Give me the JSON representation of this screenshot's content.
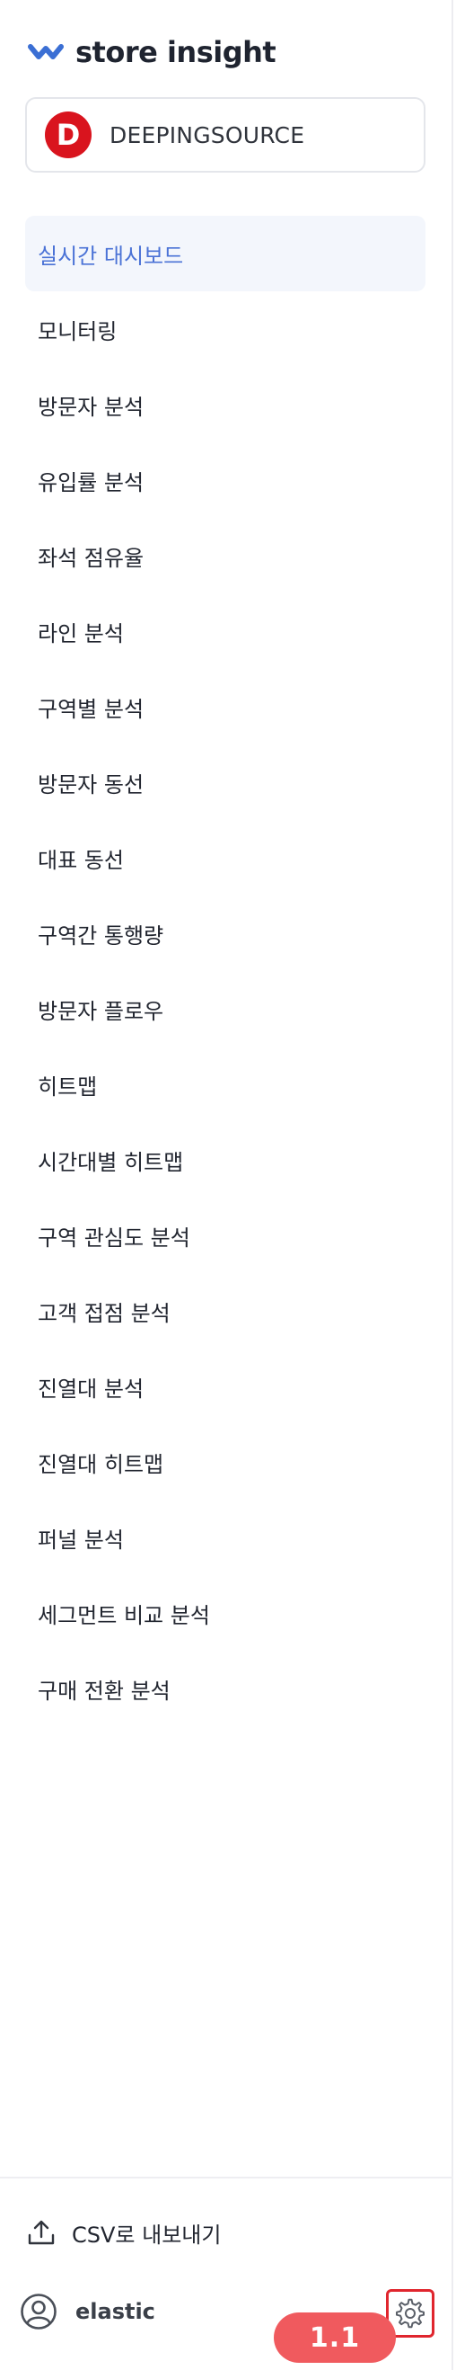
{
  "app": {
    "logo_text": "store insight",
    "brand_color": "#3b6fd4"
  },
  "store": {
    "initial": "D",
    "name": "DEEPINGSOURCE",
    "avatar_color": "#d9141e"
  },
  "nav": {
    "items": [
      {
        "label": "실시간 대시보드",
        "active": true
      },
      {
        "label": "모니터링"
      },
      {
        "label": "방문자 분석"
      },
      {
        "label": "유입률 분석"
      },
      {
        "label": "좌석 점유율"
      },
      {
        "label": "라인 분석"
      },
      {
        "label": "구역별 분석"
      },
      {
        "label": "방문자 동선"
      },
      {
        "label": "대표 동선"
      },
      {
        "label": "구역간 통행량"
      },
      {
        "label": "방문자 플로우"
      },
      {
        "label": "히트맵"
      },
      {
        "label": "시간대별 히트맵"
      },
      {
        "label": "구역 관심도 분석"
      },
      {
        "label": "고객 접점 분석"
      },
      {
        "label": "진열대 분석"
      },
      {
        "label": "진열대 히트맵"
      },
      {
        "label": "퍼널 분석"
      },
      {
        "label": "세그먼트 비교 분석"
      },
      {
        "label": "구매 전환 분석"
      }
    ]
  },
  "footer": {
    "csv_label": "CSV로 내보내기",
    "username": "elastic",
    "version": "1.1",
    "icons": {
      "export": "upload-icon",
      "user": "user-circle-icon",
      "settings": "gear-icon"
    }
  }
}
